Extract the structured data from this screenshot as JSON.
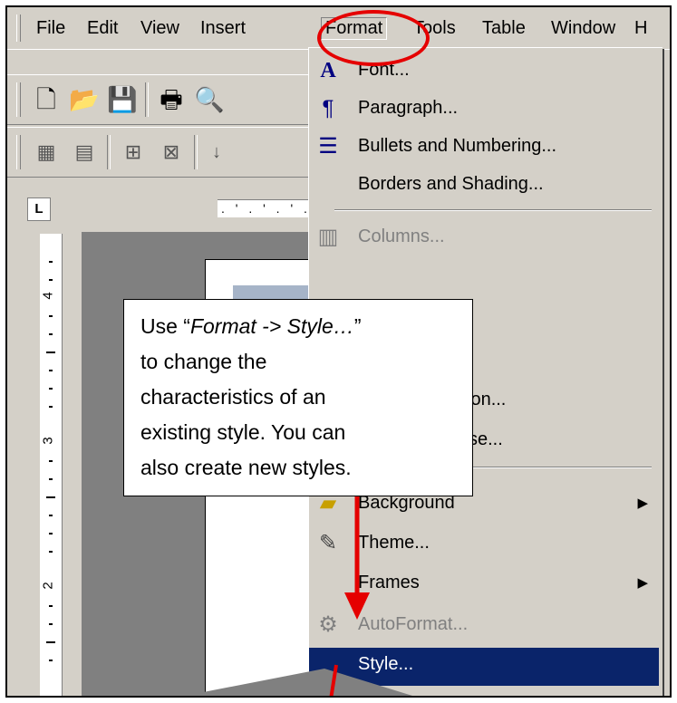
{
  "menubar": {
    "items": [
      "File",
      "Edit",
      "View",
      "Insert",
      "Format",
      "Tools",
      "Table",
      "Window",
      "H"
    ]
  },
  "format_menu": {
    "items": [
      {
        "label": "Font...",
        "icon": "font-icon",
        "glyph": "A",
        "disabled": false,
        "submenu": false
      },
      {
        "label": "Paragraph...",
        "icon": "paragraph-icon",
        "glyph": "¶",
        "disabled": false,
        "submenu": false
      },
      {
        "label": "Bullets and Numbering...",
        "icon": "bullets-icon",
        "glyph": "☰",
        "disabled": false,
        "submenu": false
      },
      {
        "label": "Borders and Shading...",
        "icon": "",
        "glyph": "",
        "disabled": false,
        "submenu": false
      },
      {
        "label": "Columns...",
        "icon": "columns-icon",
        "glyph": "▥",
        "disabled": true,
        "submenu": false
      },
      {
        "label": "ion...",
        "icon": "",
        "glyph": "",
        "disabled": false,
        "submenu": false
      },
      {
        "label": "se...",
        "icon": "",
        "glyph": "",
        "disabled": false,
        "submenu": false
      },
      {
        "label": "Background",
        "icon": "background-icon",
        "glyph": "▰",
        "disabled": false,
        "submenu": true
      },
      {
        "label": "Theme...",
        "icon": "theme-icon",
        "glyph": "✎",
        "disabled": false,
        "submenu": false
      },
      {
        "label": "Frames",
        "icon": "",
        "glyph": "",
        "disabled": false,
        "submenu": true
      },
      {
        "label": "AutoFormat...",
        "icon": "autoformat-icon",
        "glyph": "⚙",
        "disabled": true,
        "submenu": false
      },
      {
        "label": "Style...",
        "icon": "",
        "glyph": "",
        "disabled": false,
        "submenu": false,
        "selected": true
      }
    ]
  },
  "toolbar1": {
    "icons": [
      "new-document-icon",
      "open-folder-icon",
      "save-icon",
      "print-icon",
      "print-preview-icon"
    ]
  },
  "toolbar2": {
    "icons": [
      "form-icon",
      "properties-icon",
      "table-insert-icon",
      "table-delete-icon",
      "sort-icon"
    ]
  },
  "ruler": {
    "tab_selector": "L",
    "marks": ". ' . ' . ' ."
  },
  "vertical_ruler": {
    "numbers": [
      "4",
      "3",
      "2"
    ]
  },
  "callout": {
    "prefix": "Use “",
    "emphasis": "Format -> Style…",
    "suffix": "”",
    "lines": [
      "to change the",
      "characteristics of an",
      "existing style. You can",
      "also create new styles."
    ]
  },
  "colors": {
    "highlight": "#e50000",
    "selection": "#0a246a",
    "menu_bg": "#d4d0c8"
  }
}
